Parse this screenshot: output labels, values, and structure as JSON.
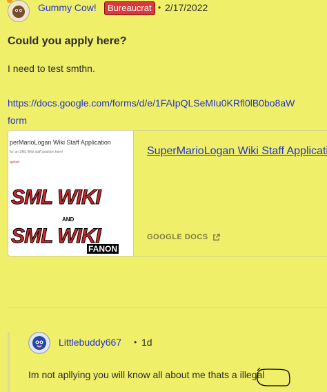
{
  "post": {
    "author": "Gummy Cow!",
    "badge": "Bureaucrat",
    "separator": "•",
    "date": "2/17/2022",
    "title": "Could you apply here?",
    "body": "I need to test smthn.",
    "link_line1": "https://docs.google.com/forms/d/e/1FAIpQLSeMIu0KRfl0lB0bo8aW",
    "link_line2": "form"
  },
  "embed": {
    "thumb_caption": "perMarioLogan Wiki Staff Application",
    "thumb_sub": "for an SML Wiki staff position here!",
    "thumb_required": "quired",
    "logo_top": "SML WIKI",
    "logo_and": "AND",
    "logo_bottom": "SML WIKI",
    "logo_fanon": "FANON",
    "title": "SuperMarioLogan Wiki Staff Application",
    "source": "GOOGLE DOCS",
    "external_icon": "external-link-icon"
  },
  "reply": {
    "author": "Littlebuddy667",
    "separator": "•",
    "time": "1d",
    "body": "Im not apllying you will know all about me thats a illegal"
  },
  "colors": {
    "background": "#f0ef6a",
    "link": "#2233cc",
    "badge": "#d83a3a"
  }
}
